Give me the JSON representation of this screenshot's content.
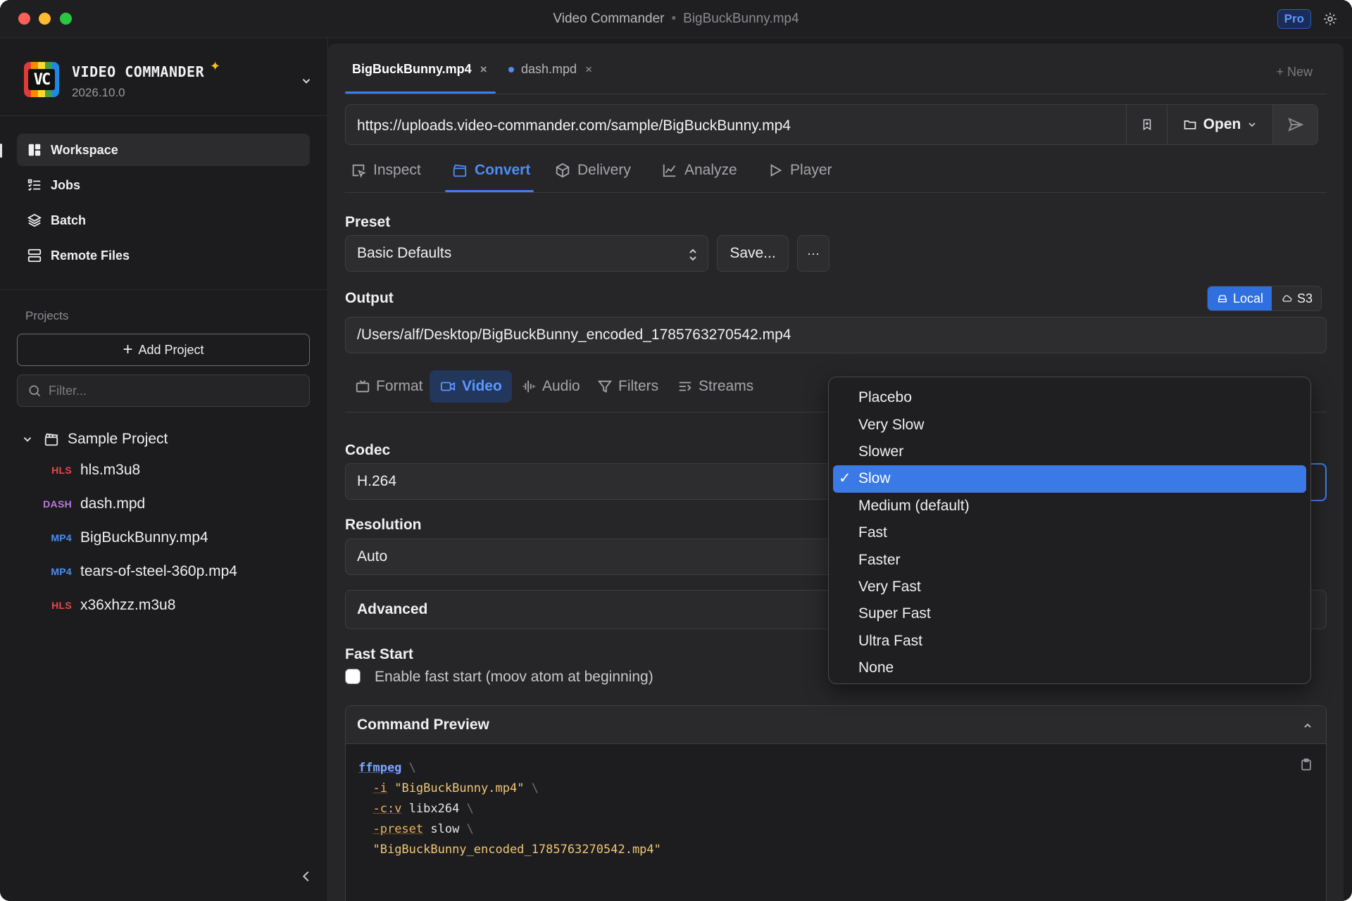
{
  "window": {
    "app_title": "Video Commander",
    "file_title": "BigBuckBunny.mp4",
    "badge": "Pro"
  },
  "sidebar": {
    "brand_name": "VIDEO COMMANDER",
    "logo_text": "VC",
    "version": "2026.10.0",
    "nav": [
      {
        "label": "Workspace",
        "icon": "workspace-icon",
        "active": true
      },
      {
        "label": "Jobs",
        "icon": "jobs-list-icon",
        "active": false
      },
      {
        "label": "Batch",
        "icon": "layers-icon",
        "active": false
      },
      {
        "label": "Remote Files",
        "icon": "server-icon",
        "active": false
      }
    ],
    "projects_label": "Projects",
    "add_project": "Add Project",
    "filter_placeholder": "Filter...",
    "project": {
      "name": "Sample Project",
      "files": [
        {
          "tag": "HLS",
          "name": "hls.m3u8",
          "color": "#e5484d"
        },
        {
          "tag": "DASH",
          "name": "dash.mpd",
          "color": "#b77be0"
        },
        {
          "tag": "MP4",
          "name": "BigBuckBunny.mp4",
          "color": "#4b8cf5"
        },
        {
          "tag": "MP4",
          "name": "tears-of-steel-360p.mp4",
          "color": "#4b8cf5"
        },
        {
          "tag": "HLS",
          "name": "x36xhzz.m3u8",
          "color": "#e5484d"
        }
      ]
    }
  },
  "doc_tabs": {
    "tabs": [
      {
        "label": "BigBuckBunny.mp4",
        "active": true
      },
      {
        "label": "dash.mpd",
        "active": false,
        "modified": true
      }
    ],
    "close": "×",
    "new_label": "+ New"
  },
  "url_bar": {
    "url": "https://uploads.video-commander.com/sample/BigBuckBunny.mp4",
    "open_label": "Open"
  },
  "mode_tabs": [
    {
      "label": "Inspect",
      "icon": "inspect-icon",
      "active": false
    },
    {
      "label": "Convert",
      "icon": "convert-icon",
      "active": true
    },
    {
      "label": "Delivery",
      "icon": "package-icon",
      "active": false
    },
    {
      "label": "Analyze",
      "icon": "chart-icon",
      "active": false
    },
    {
      "label": "Player",
      "icon": "play-icon",
      "active": false
    }
  ],
  "convert": {
    "preset_label": "Preset",
    "preset_value": "Basic Defaults",
    "save_label": "Save...",
    "more_label": "···",
    "output_label": "Output",
    "output_targets": {
      "local": "Local",
      "s3": "S3",
      "selected": "Local"
    },
    "output_path": "/Users/alf/Desktop/BigBuckBunny_encoded_1785763270542.mp4",
    "sub_tabs": [
      {
        "label": "Format",
        "active": false
      },
      {
        "label": "Video",
        "active": true
      },
      {
        "label": "Audio",
        "active": false
      },
      {
        "label": "Filters",
        "active": false
      },
      {
        "label": "Streams",
        "active": false
      }
    ],
    "codec_label": "Codec",
    "codec_value": "H.264",
    "resolution_label": "Resolution",
    "resolution_value": "Auto",
    "advanced_label": "Advanced",
    "fast_start_label": "Fast Start",
    "fast_start_check": "Enable fast start (moov atom at beginning)",
    "fast_start_checked": false
  },
  "command_preview": {
    "title": "Command Preview",
    "cmd": "ffmpeg",
    "backslash": "\\",
    "lines": [
      {
        "flag": "-i",
        "value": "\"BigBuckBunny.mp4\""
      },
      {
        "flag": "-c:v",
        "value": "libx264"
      },
      {
        "flag": "-preset",
        "value": "slow"
      }
    ],
    "output": "\"BigBuckBunny_encoded_1785763270542.mp4\""
  },
  "preset_dropdown": {
    "selected": "Slow",
    "check": "✓",
    "options": [
      "Placebo",
      "Very Slow",
      "Slower",
      "Slow",
      "Medium (default)",
      "Fast",
      "Faster",
      "Very Fast",
      "Super Fast",
      "Ultra Fast",
      "None"
    ]
  },
  "colors": {
    "accent": "#3d7ef0",
    "background": "#1c1c1e",
    "panel": "#262628"
  }
}
